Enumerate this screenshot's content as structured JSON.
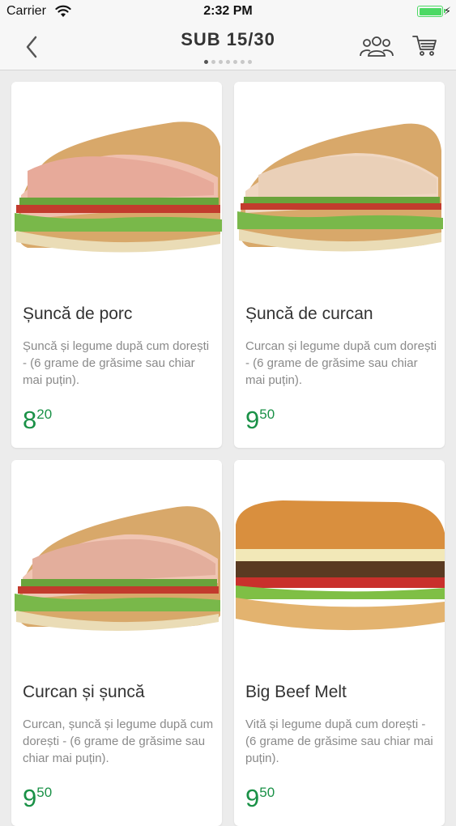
{
  "status_bar": {
    "carrier": "Carrier",
    "time": "2:32 PM"
  },
  "nav": {
    "title": "SUB 15/30",
    "page_count": 7,
    "active_page": 0
  },
  "products": [
    {
      "name": "Șuncă de porc",
      "description": "Șuncă și legume după cum dorești - (6 grame de grăsime sau chiar mai puțin).",
      "price_int": "8",
      "price_dec": "20"
    },
    {
      "name": "Șuncă de curcan",
      "description": "Curcan și legume după cum dorești - (6 grame de grăsime sau chiar mai puțin).",
      "price_int": "9",
      "price_dec": "50"
    },
    {
      "name": "Curcan și șuncă",
      "description": "Curcan, șuncă și legume după cum dorești - (6 grame de grăsime sau chiar mai puțin).",
      "price_int": "9",
      "price_dec": "50"
    },
    {
      "name": "Big Beef Melt",
      "description": "Vită și legume după cum dorești - (6 grame de grăsime sau chiar mai puțin).",
      "price_int": "9",
      "price_dec": "50"
    }
  ],
  "colors": {
    "price_green": "#1a9147",
    "battery_green": "#4cd964"
  },
  "icons": {
    "back": "chevron-left-icon",
    "group": "group-icon",
    "cart": "cart-icon"
  }
}
